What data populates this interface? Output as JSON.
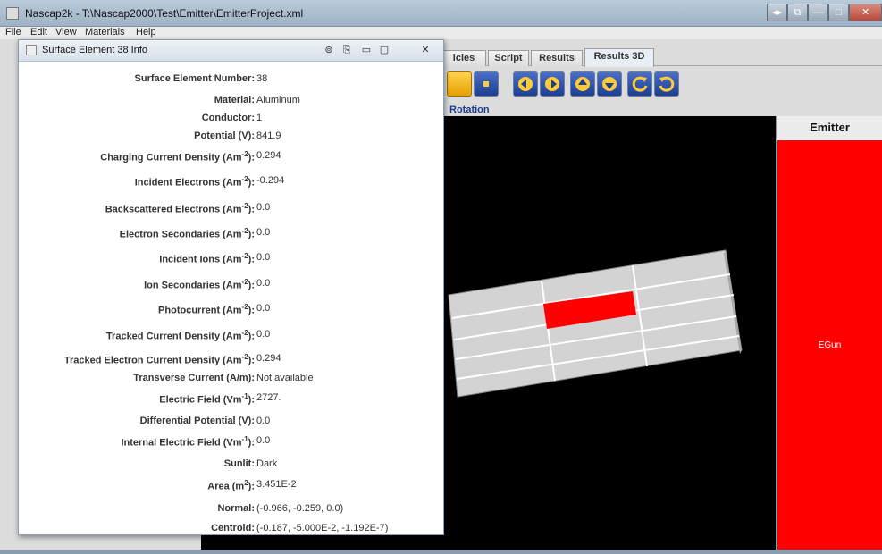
{
  "window": {
    "title": "Nascap2k - T:\\Nascap2000\\Test\\Emitter\\EmitterProject.xml",
    "controls": [
      "◂▸",
      "⧉",
      "—",
      "□",
      "✕"
    ]
  },
  "menu": [
    "File",
    "Edit",
    "View",
    "Materials",
    "Help"
  ],
  "tabs": [
    {
      "label": "icles",
      "active": false
    },
    {
      "label": "Script",
      "active": false
    },
    {
      "label": "Results",
      "active": false
    },
    {
      "label": "Results 3D",
      "active": true
    }
  ],
  "toolbar": {
    "buttons": [
      "surface-display-icon",
      "points-icon",
      "rotate-left-icon",
      "rotate-right-icon",
      "rotate-up-icon",
      "rotate-down-icon",
      "rotate-ccw-icon",
      "rotate-cw-icon"
    ],
    "section_label": "Rotation"
  },
  "legend": {
    "header": "Emitter",
    "label": "EGun",
    "color": "#ff0000"
  },
  "dialog": {
    "title": "Surface Element 38 Info",
    "fields": [
      {
        "label": "Surface Element Number:",
        "value": "38"
      },
      {
        "label": "Material:",
        "value": "Aluminum"
      },
      {
        "label": "Conductor:",
        "value": "1"
      },
      {
        "label": "Potential (V):",
        "value": "841.9"
      },
      {
        "label": "Charging Current Density (Am",
        "sup": "-2",
        "tail": "):",
        "value": "0.294"
      },
      {
        "label": "Incident Electrons (Am",
        "sup": "-2",
        "tail": "):",
        "value": "-0.294"
      },
      {
        "label": "Backscattered Electrons (Am",
        "sup": "-2",
        "tail": "):",
        "value": "0.0"
      },
      {
        "label": "Electron Secondaries (Am",
        "sup": "-2",
        "tail": "):",
        "value": "0.0"
      },
      {
        "label": "Incident Ions (Am",
        "sup": "-2",
        "tail": "):",
        "value": "0.0"
      },
      {
        "label": "Ion Secondaries (Am",
        "sup": "-2",
        "tail": "):",
        "value": "0.0"
      },
      {
        "label": "Photocurrent (Am",
        "sup": "-2",
        "tail": "):",
        "value": "0.0"
      },
      {
        "label": "Tracked Current Density (Am",
        "sup": "-2",
        "tail": "):",
        "value": "0.0"
      },
      {
        "label": "Tracked Electron Current Density (Am",
        "sup": "-2",
        "tail": "):",
        "value": "0.294"
      },
      {
        "label": "Transverse Current (A/m):",
        "value": "Not available"
      },
      {
        "label": "Electric Field (Vm",
        "sup": "-1",
        "tail": "):",
        "value": "2727."
      },
      {
        "label": "Differential Potential (V):",
        "value": "0.0"
      },
      {
        "label": "Internal Electric Field (Vm",
        "sup": "-1",
        "tail": "):",
        "value": "0.0"
      },
      {
        "label": "Sunlit:",
        "value": "Dark"
      },
      {
        "label": "Area (m",
        "sup": "2",
        "tail": "):",
        "value": "3.451E-2"
      },
      {
        "label": "Normal:",
        "value": "(-0.966, -0.259, 0.0)"
      },
      {
        "label": "Centroid:",
        "value": "(-0.187, -5.000E-2, -1.192E-7)"
      }
    ]
  },
  "colors": {
    "selected_element": "#ff0000",
    "view_background": "#000000",
    "mesh": "#d3d3d3"
  }
}
